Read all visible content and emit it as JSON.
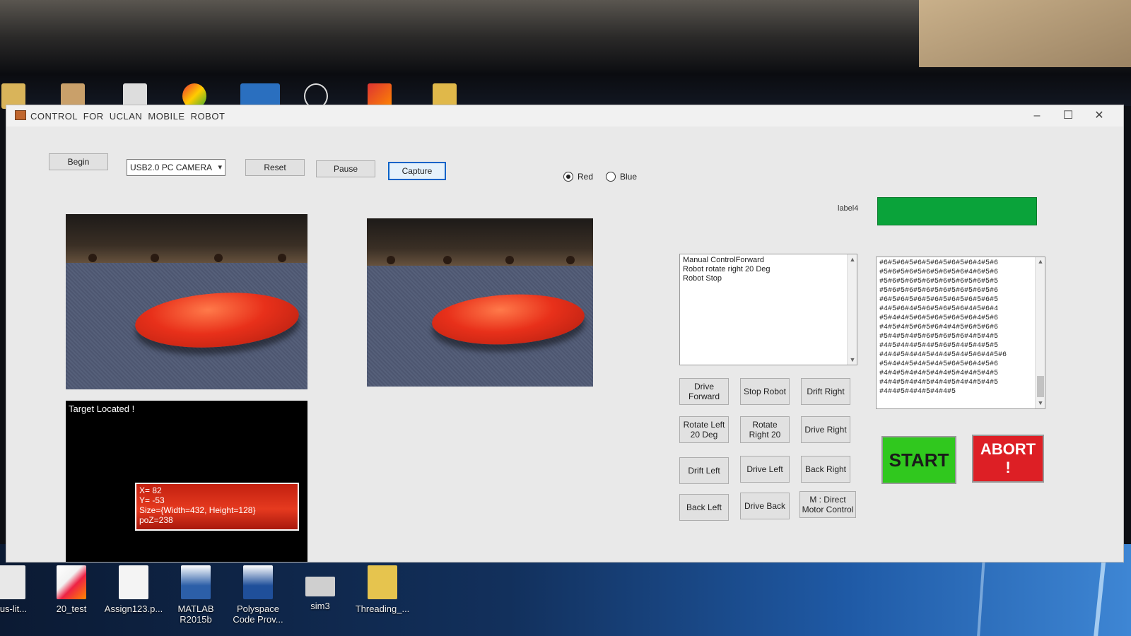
{
  "window": {
    "title": "CONTROL FOR UCLAN MOBILE ROBOT",
    "min_glyph": "–",
    "max_glyph": "☐",
    "close_glyph": "✕"
  },
  "toolbar": {
    "begin_label": "Begin",
    "camera_select": "USB2.0 PC CAMERA",
    "reset_label": "Reset",
    "pause_label": "Pause",
    "capture_label": "Capture"
  },
  "color_select": {
    "red_label": "Red",
    "blue_label": "Blue",
    "selected": "Red"
  },
  "tracking": {
    "status_text": "Target Located !",
    "info": [
      "X= 82",
      "Y= -53",
      "Size={Width=432, Height=128}",
      "poZ=238"
    ]
  },
  "label4": "label4",
  "status_bar_color": "#0aa33a",
  "log_lines": [
    "Manual ControlForward",
    "Robot rotate right 20 Deg",
    "Robot Stop"
  ],
  "serial_lines": [
    "#6#5#6#5#6#5#6#5#6#5#6#4#5#6",
    "#5#6#5#6#5#6#5#6#5#6#4#6#5#6",
    "#5#6#5#6#5#6#5#6#5#6#5#6#5#5",
    "#5#6#5#6#5#6#5#6#5#6#5#6#5#6",
    "#6#5#6#5#6#5#6#5#6#5#6#5#6#5",
    "#4#5#6#4#5#6#5#6#5#6#4#5#6#4",
    "#5#4#4#5#6#5#6#5#6#5#6#4#5#6",
    "#4#5#4#5#6#5#6#4#4#5#6#5#6#6",
    "#5#4#5#4#5#6#5#6#5#6#4#5#4#5",
    "#4#5#4#4#5#4#5#6#5#4#5#4#5#5",
    "#4#4#5#4#4#5#4#4#5#4#5#6#4#5#6",
    "#5#4#4#5#4#5#4#5#6#5#6#4#5#6",
    "#4#4#5#4#4#5#4#4#5#4#4#5#4#5",
    "#4#4#5#4#4#5#4#4#5#4#4#5#4#5",
    "#4#4#5#4#4#5#4#4#5"
  ],
  "controls": {
    "drive_forward": "Drive\nForward",
    "stop_robot": "Stop Robot",
    "drift_right": "Drift Right",
    "rotate_left": "Rotate Left\n20 Deg",
    "rotate_right": "Rotate\nRight 20",
    "drive_right": "Drive Right",
    "drift_left": "Drift Left",
    "drive_left": "Drive Left",
    "back_right": "Back Right",
    "back_left": "Back Left",
    "drive_back": "Drive Back",
    "direct_motor": "M : Direct\nMotor Control"
  },
  "start_label": "START",
  "abort_label": "ABORT\n!",
  "desktop_icons": [
    {
      "label": "rtus-lit...",
      "icon": "document-icon"
    },
    {
      "label": "20_test",
      "icon": "matlab-file-icon"
    },
    {
      "label": "Assign123.p...",
      "icon": "blank-file-icon"
    },
    {
      "label": "MATLAB\nR2015b",
      "icon": "matlab-icon"
    },
    {
      "label": "Polyspace\nCode Prov...",
      "icon": "polyspace-icon"
    },
    {
      "label": "sim3",
      "icon": "sim-icon"
    },
    {
      "label": "Threading_...",
      "icon": "folder-icon"
    }
  ]
}
